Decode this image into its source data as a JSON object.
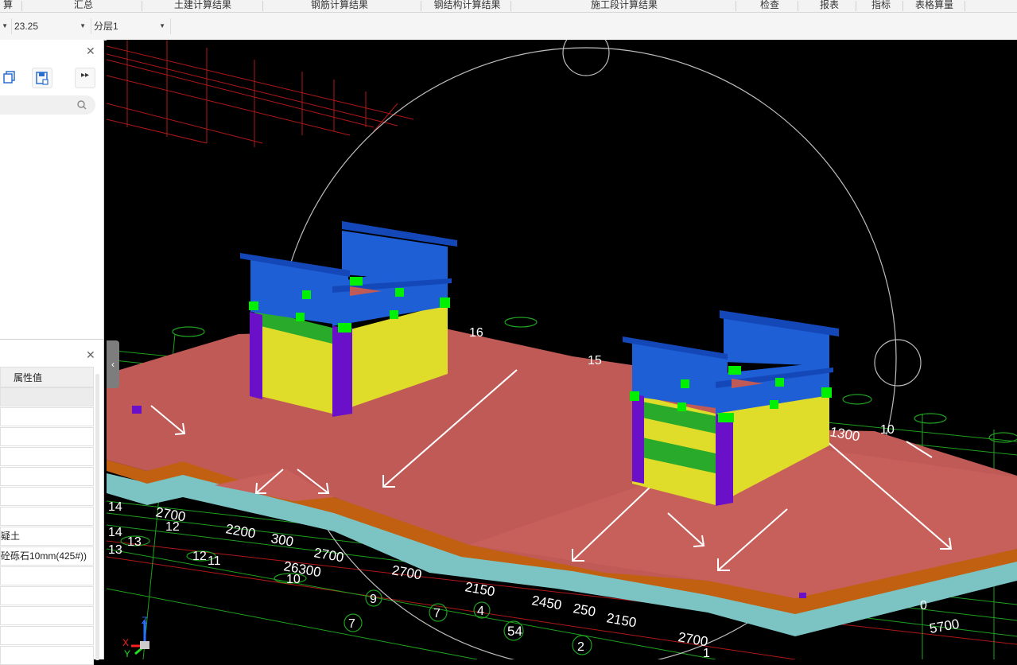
{
  "menubar": {
    "items": [
      "算",
      "汇总",
      "土建计算结果",
      "钢筋计算结果",
      "钢结构计算结果",
      "施工段计算结果",
      "检查",
      "报表",
      "指标",
      "表格算量"
    ]
  },
  "toolbar": {
    "elevation_value": "23.25",
    "layer_value": "分层1"
  },
  "properties_panel": {
    "header_value": "属性值",
    "row_concrete": "疑土",
    "row_gravel": "砼砾石10mm(425#))"
  },
  "viewport": {
    "dimension_labels": [
      "2700",
      "2700",
      "2700",
      "2700",
      "2200",
      "26300",
      "2450",
      "2150",
      "2150",
      "5700",
      "1300",
      "300",
      "250",
      "54"
    ],
    "axis_labels": [
      "14",
      "14",
      "13",
      "13",
      "12",
      "12",
      "11",
      "10",
      "9",
      "7",
      "7",
      "4",
      "2",
      "1",
      "16",
      "15",
      "10",
      "0"
    ],
    "axis_x": "X",
    "axis_y": "Y",
    "axis_z": "Z"
  },
  "colors": {
    "slab": "#c05a57",
    "beam_edge": "#c06010",
    "foundation": "#7cc4c4",
    "block_blue": "#1e5fd6",
    "block_yellow": "#e0dc2a",
    "band_green": "#2aaa2a",
    "column_purple": "#6a10c8",
    "marker_green": "#00f000",
    "gridline_green": "#1fa01f",
    "gridline_red": "#b01818"
  },
  "icons": [
    "close-icon",
    "copy-icon",
    "save-layer-icon",
    "expand-icon",
    "search-icon",
    "chevron-left-icon",
    "dropdown-caret-icon"
  ]
}
